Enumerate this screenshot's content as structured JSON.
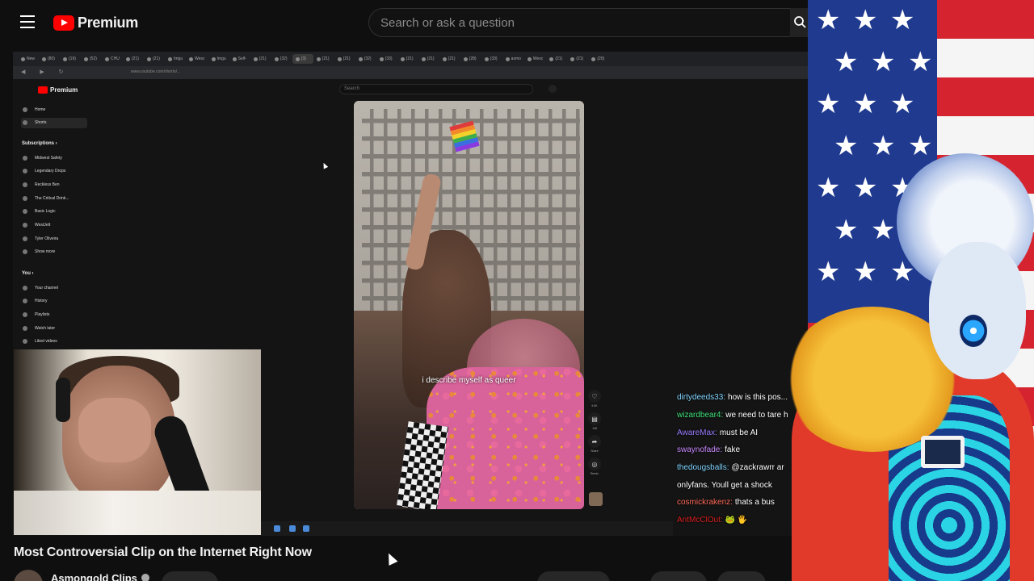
{
  "header": {
    "logo_text": "Premium",
    "search_placeholder": "Search or ask a question"
  },
  "inner_browser": {
    "tabs": [
      "New",
      "(80)",
      "(19)",
      "(52)",
      "CHU",
      "(21)",
      "(21)",
      "Imgu",
      "Wesc",
      "Imgu",
      "Self-",
      "(21)",
      "(32)",
      "(3)",
      "(21)",
      "(21)",
      "(32)",
      "(33)",
      "(21)",
      "(21)",
      "(21)",
      "(28)",
      "(33)",
      "asmo",
      "Wesc",
      "(21)",
      "(21)",
      "(20)"
    ],
    "active_tab_index": 13,
    "url": "www.youtube.com/shorts/..."
  },
  "inner_youtube": {
    "logo_text": "Premium",
    "search_placeholder": "Search",
    "nav": [
      {
        "label": "Home",
        "icon": "home-icon"
      },
      {
        "label": "Shorts",
        "icon": "shorts-icon",
        "active": true
      }
    ],
    "subscriptions_heading": "Subscriptions",
    "subscriptions": [
      "Midwest Safety",
      "Legendary Drops",
      "Reckless Ben",
      "The Critical Drink...",
      "Basic Logic",
      "WestJett",
      "Tyler Oliveira",
      "Show more"
    ],
    "you_heading": "You",
    "you_items": [
      "Your channel",
      "History",
      "Playlists",
      "Watch later",
      "Liked videos"
    ]
  },
  "short": {
    "caption": "i describe myself as queer",
    "actions": [
      {
        "icon": "like-icon",
        "label": "5.5K"
      },
      {
        "icon": "comment-icon",
        "label": "148"
      },
      {
        "icon": "share-icon",
        "label": "Share"
      },
      {
        "icon": "remix-icon",
        "label": "Remix"
      }
    ]
  },
  "chat": [
    {
      "user": "dirtydeeds33",
      "color": "#7fd4ff",
      "msg": "how is this pos..."
    },
    {
      "user": "wizardbear4",
      "color": "#3ee07a",
      "msg": "we need to tare h"
    },
    {
      "user": "AwareMax",
      "color": "#9a7cff",
      "msg": "must be AI"
    },
    {
      "user": "swaynofade",
      "color": "#c98aff",
      "msg": "fake"
    },
    {
      "user": "thedougsballs",
      "color": "#7fd4ff",
      "msg": "@zackrawrr ar"
    },
    {
      "user": "",
      "color": "#ffffff",
      "msg": "onlyfans. Youll get a shock"
    },
    {
      "user": "cosmickrakenz",
      "color": "#ff6a5a",
      "msg": "thats a bus"
    },
    {
      "user": "AntMcClOut",
      "color": "#d81e1e",
      "msg": "🐸 🖐"
    }
  ],
  "video": {
    "title": "Most Controversial Clip on the Internet Right Now",
    "channel": "Asmongold Clips"
  }
}
